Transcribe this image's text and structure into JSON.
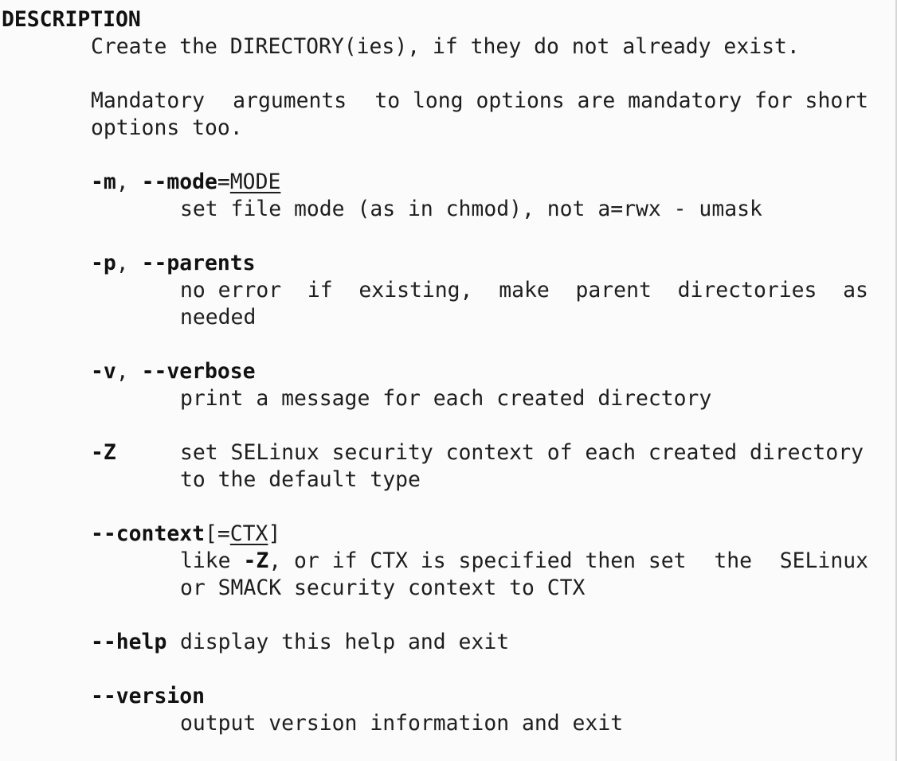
{
  "section_heading": "DESCRIPTION",
  "intro": {
    "line1": "Create the DIRECTORY(ies), if they do not already exist.",
    "mandatory_words": [
      "Mandatory",
      "arguments",
      "to long options are mandatory for short"
    ],
    "mandatory_line2": "options too."
  },
  "options": {
    "mode": {
      "short": "-m",
      "sep": ", ",
      "long": "--mode",
      "eq": "=",
      "arg": "MODE",
      "desc1": "set file mode (as in chmod), not a=rwx - umask"
    },
    "parents": {
      "short": "-p",
      "sep": ", ",
      "long": "--parents",
      "desc1_words": [
        "no error",
        "if",
        "existing,",
        "make",
        "parent",
        "directories",
        "as"
      ],
      "desc2": "needed"
    },
    "verbose": {
      "short": "-v",
      "sep": ", ",
      "long": "--verbose",
      "desc1": "print a message for each created directory"
    },
    "selinux": {
      "short": "-Z",
      "desc1": "set SELinux security context of each created directory",
      "desc2": "to the default type"
    },
    "context": {
      "long": "--context",
      "open": "[=",
      "arg": "CTX",
      "close": "]",
      "desc1_pre": "like ",
      "desc1_flag": "-Z",
      "desc1_words": [
        ", or if CTX is specified then set",
        "the",
        "SELinux"
      ],
      "desc2": "or SMACK security context to CTX"
    },
    "help": {
      "long": "--help",
      "desc1": "display this help and exit"
    },
    "version": {
      "long": "--version",
      "desc1": "output version information and exit"
    }
  }
}
